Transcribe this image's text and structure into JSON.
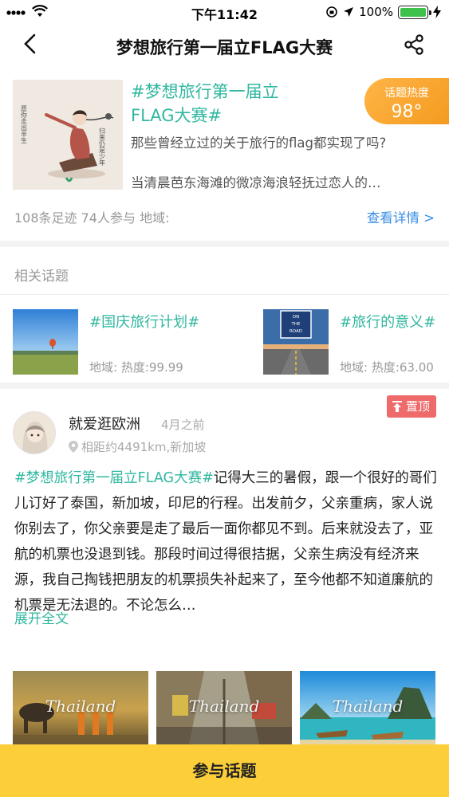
{
  "status_bar": {
    "time": "下午11:42",
    "battery": "100%",
    "battery_level": 1.0,
    "battery_color": "#3dc24b"
  },
  "nav": {
    "title": "梦想旅行第一届立FLAG大赛",
    "back_icon": "chevron-left-icon",
    "share_icon": "share-icon"
  },
  "topic": {
    "title_line1": "#梦想旅行第一届立",
    "title_line2": "FLAG大赛#",
    "heat_label": "话题热度",
    "heat_value": "98°",
    "description": "那些曾经立过的关于旅行的flag都实现了吗?",
    "excerpt": "当清晨芭东海滩的微凉海浪轻抚过恋人的…",
    "stats": "108条足迹 74人参与 地域:",
    "detail_link": "查看详情 >",
    "cover_caption_left": "愿你走出半生",
    "cover_caption_right": "归来仍是少年",
    "accent": "#30b7a0",
    "heat_color": "#f39b1f"
  },
  "related": {
    "label": "相关话题",
    "items": [
      {
        "title": "#国庆旅行计划#",
        "meta": "地域: 热度:99.99"
      },
      {
        "title": "#旅行的意义#",
        "meta": "地域: 热度:63.00",
        "sign": "ON THE ROAD"
      }
    ]
  },
  "post": {
    "username": "就爱逛欧洲",
    "time_ago": "4月之前",
    "location": "相距约4491km,新加坡",
    "pin_label": "置顶",
    "pin_color": "#ef6a6a",
    "tag": "#梦想旅行第一届立FLAG大赛#",
    "body": "记得大三的暑假，跟一个很好的哥们儿订好了泰国，新加坡，印尼的行程。出发前夕，父亲重病，家人说你别去了，你父亲要是走了最后一面你都见不到。后来就没去了，亚航的机票也没退到钱。那段时间过得很拮据，父亲生病没有经济来源，我自己掏钱把朋友的机票损失补起来了，至今他都不知道廉航的机票是无法退的。不论怎么…",
    "expand": "展开全文",
    "photos": [
      {
        "caption": "Thailand"
      },
      {
        "caption": "Thailand"
      },
      {
        "caption": "Thailand"
      }
    ]
  },
  "footer": {
    "join_label": "参与话题",
    "color": "#fbce3a"
  }
}
